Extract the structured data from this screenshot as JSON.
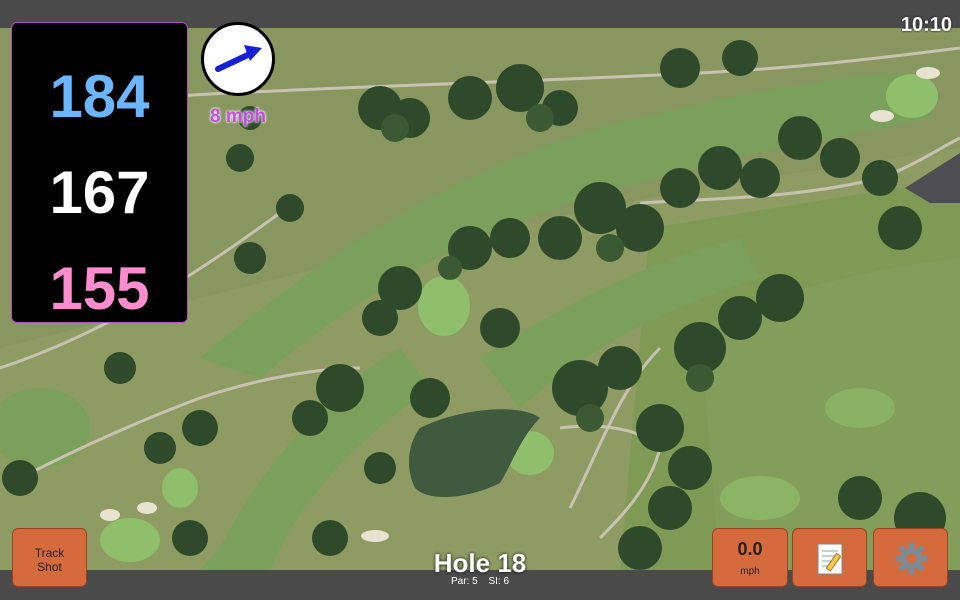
{
  "status": {
    "time": "10:10"
  },
  "distances": {
    "back": "184",
    "middle": "167",
    "front": "155",
    "colors": {
      "back": "#6cb6ff",
      "middle": "#ffffff",
      "front": "#ff8ccf"
    }
  },
  "wind": {
    "speed": "8 mph",
    "icon": "wind-direction-arrow-icon"
  },
  "buttons": {
    "track_shot": "Track\nShot",
    "speed_value": "0.0",
    "speed_unit": "mph",
    "notes_icon": "notepad-icon",
    "settings_icon": "gear-icon"
  },
  "hole": {
    "title": "Hole 18",
    "par": "Par: 5",
    "si": "SI: 6"
  },
  "colors": {
    "button_bg": "#d56a3c",
    "panel_border": "#b04fc0",
    "wind_text": "#c24fe0"
  }
}
